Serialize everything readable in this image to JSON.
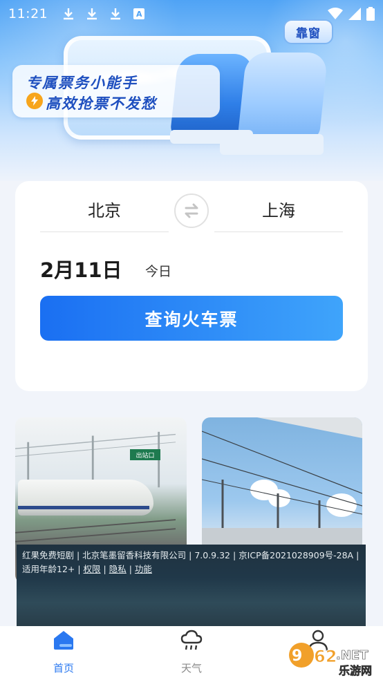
{
  "status_bar": {
    "time": "11:21",
    "notification_icons": [
      "download-icon",
      "download-icon",
      "download-icon",
      "a-icon"
    ],
    "a_badge": "A"
  },
  "banner": {
    "slogan_line1": "专属票务小能手",
    "slogan_line2": "高效抢票不发愁",
    "window_tag": "靠窗"
  },
  "search": {
    "from_city": "北京",
    "to_city": "上海",
    "date": "2月11日",
    "date_note": "今日",
    "query_button": "查询火车票"
  },
  "photo_cards": [
    {
      "sign_text": "出站口"
    },
    {}
  ],
  "overlay": {
    "text_prefix": "红果免费短剧 | 北京笔墨留香科技有限公司 | 7.0.9.32 | 京ICP备2021028909号-28A | 适用年龄12+ | ",
    "link_permissions": "权限",
    "sep1": " | ",
    "link_privacy": "隐私",
    "sep2": " | ",
    "link_features": "功能"
  },
  "bottom_nav": {
    "items": [
      {
        "label": "首页",
        "icon": "home-icon",
        "active": true
      },
      {
        "label": "天气",
        "icon": "cloud-rain-icon",
        "active": false
      },
      {
        "label": "",
        "icon": "user-icon",
        "active": false
      }
    ]
  },
  "watermark": {
    "brand": "962.NET",
    "sub": "乐游网"
  },
  "colors": {
    "primary": "#2a78f0",
    "slogan": "#1e4fbf",
    "bolt": "#f7a51c"
  }
}
